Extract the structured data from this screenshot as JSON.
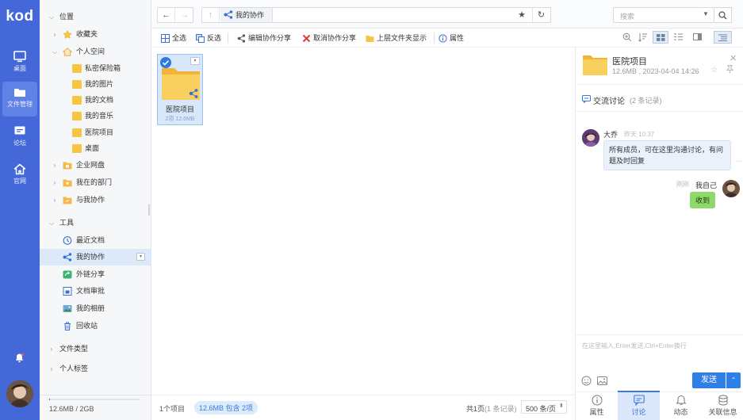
{
  "app": {
    "logo": "kod"
  },
  "nav": {
    "items": [
      {
        "label": "桌面",
        "icon": "desktop-icon"
      },
      {
        "label": "文件管理",
        "icon": "folder-icon"
      },
      {
        "label": "论坛",
        "icon": "forum-icon"
      },
      {
        "label": "官网",
        "icon": "home-icon"
      }
    ],
    "active": 1
  },
  "tree": {
    "location_header": "位置",
    "favorites": "收藏夹",
    "personal_space": "个人空间",
    "personal_children": [
      "私密保险箱",
      "我的图片",
      "我的文档",
      "我的音乐",
      "医院项目",
      "桌面"
    ],
    "enterprise_disk": "企业网盘",
    "my_department": "我在的部门",
    "shared_with_me": "与我协作",
    "tools_header": "工具",
    "tools": [
      "最近文档",
      "我的协作",
      "外链分享",
      "文档审批",
      "我的相册",
      "回收站"
    ],
    "selected_tool": 1,
    "file_types": "文件类型",
    "personal_tags": "个人标签",
    "quota": "12.6MB / 2GB",
    "quota_used_fraction": 0.006
  },
  "address": {
    "path_label": "我的协作",
    "search_placeholder": "搜索"
  },
  "toolbar": {
    "select_all": "全选",
    "invert": "反选",
    "edit_share": "编辑协作分享",
    "cancel_share": "取消协作分享",
    "show_parent": "上层文件夹显示",
    "properties": "属性"
  },
  "files": [
    {
      "name": "医院项目",
      "meta": "2项 12.6MB",
      "type": "shared-folder"
    }
  ],
  "status": {
    "count": "1个项目",
    "summary": "12.6MB 包含 2项",
    "page": "共1页",
    "records": "(1 条记录)",
    "per_page": "500 条/页"
  },
  "detail": {
    "title": "医院项目",
    "meta": "12.6MB , 2023-04-04 14:26",
    "discussion_label": "交流讨论",
    "discussion_count": "(2 条记录)",
    "messages": [
      {
        "author": "大乔",
        "time": "昨天 10:37",
        "text": "所有成员，可在这里沟通讨论，有问题及时回复",
        "side": "left"
      },
      {
        "author": "我自己",
        "time": "刚刚",
        "text": "收到",
        "side": "right"
      }
    ],
    "input_placeholder": "在这里输入,Enter发送,Ctrl+Enter换行",
    "send_label": "发送",
    "tabs": [
      {
        "label": "属性",
        "icon": "info-icon"
      },
      {
        "label": "讨论",
        "icon": "chat-icon"
      },
      {
        "label": "动态",
        "icon": "bell-icon"
      },
      {
        "label": "关联信息",
        "icon": "database-icon"
      }
    ],
    "active_tab": 1
  },
  "colors": {
    "nav_bg": "#4468d8",
    "accent": "#3a79e0",
    "folder": "#f7c443",
    "chat_left_bubble": "#eaf1fb",
    "chat_right_bubble": "#8fd96b"
  }
}
